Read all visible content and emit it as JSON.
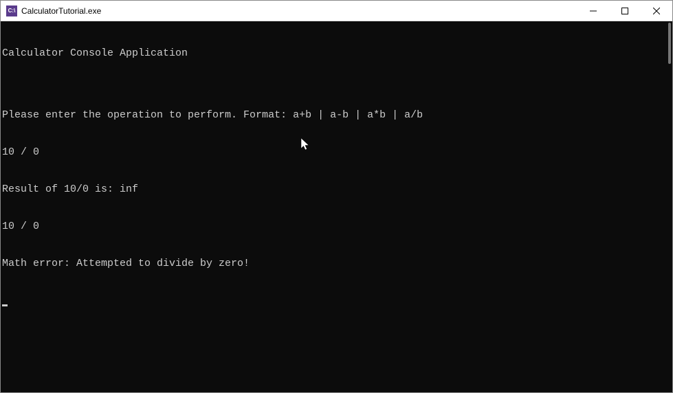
{
  "titlebar": {
    "icon_label": "C:\\",
    "title": "CalculatorTutorial.exe"
  },
  "console": {
    "lines": [
      "Calculator Console Application",
      "",
      "Please enter the operation to perform. Format: a+b | a-b | a*b | a/b",
      "10 / 0",
      "Result of 10/0 is: inf",
      "10 / 0",
      "Math error: Attempted to divide by zero!"
    ]
  }
}
